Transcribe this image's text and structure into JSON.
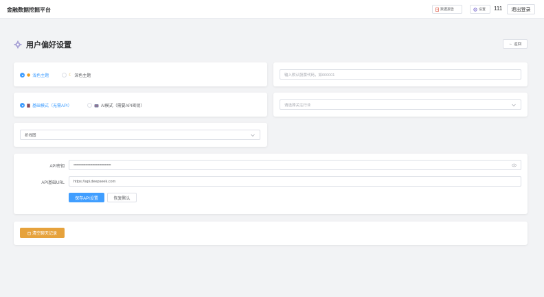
{
  "header": {
    "brand": "金融数据挖掘平台",
    "report_button": "数据报告",
    "settings_button": "设置",
    "user_count": "111",
    "logout_button": "退出登录"
  },
  "page": {
    "title": "用户偏好设置",
    "back_button": "返回"
  },
  "theme": {
    "light_label": "浅色主题",
    "dark_label": "深色主题",
    "selected": "light"
  },
  "stock_input": {
    "placeholder": "输入默认股票代码，如000001",
    "value": ""
  },
  "mode": {
    "basic_label": "基础模式（无需API）",
    "ai_label": "AI模式（需要API密钥）",
    "selected": "basic"
  },
  "industry_select": {
    "placeholder": "请选择关注行业"
  },
  "chart_select": {
    "value": "折线图"
  },
  "api": {
    "key_label": "API密钥",
    "key_value": "••••••••••••••••••••••••••••••••••••••",
    "url_label": "API基础URL",
    "url_value": "https://api.deepseek.com",
    "save_button": "保存API设置",
    "reset_button": "恢复默认"
  },
  "clear_history_button": "清空聊天记录",
  "colors": {
    "primary": "#409eff",
    "warning": "#e6a23c",
    "background": "#f2f3f5"
  }
}
